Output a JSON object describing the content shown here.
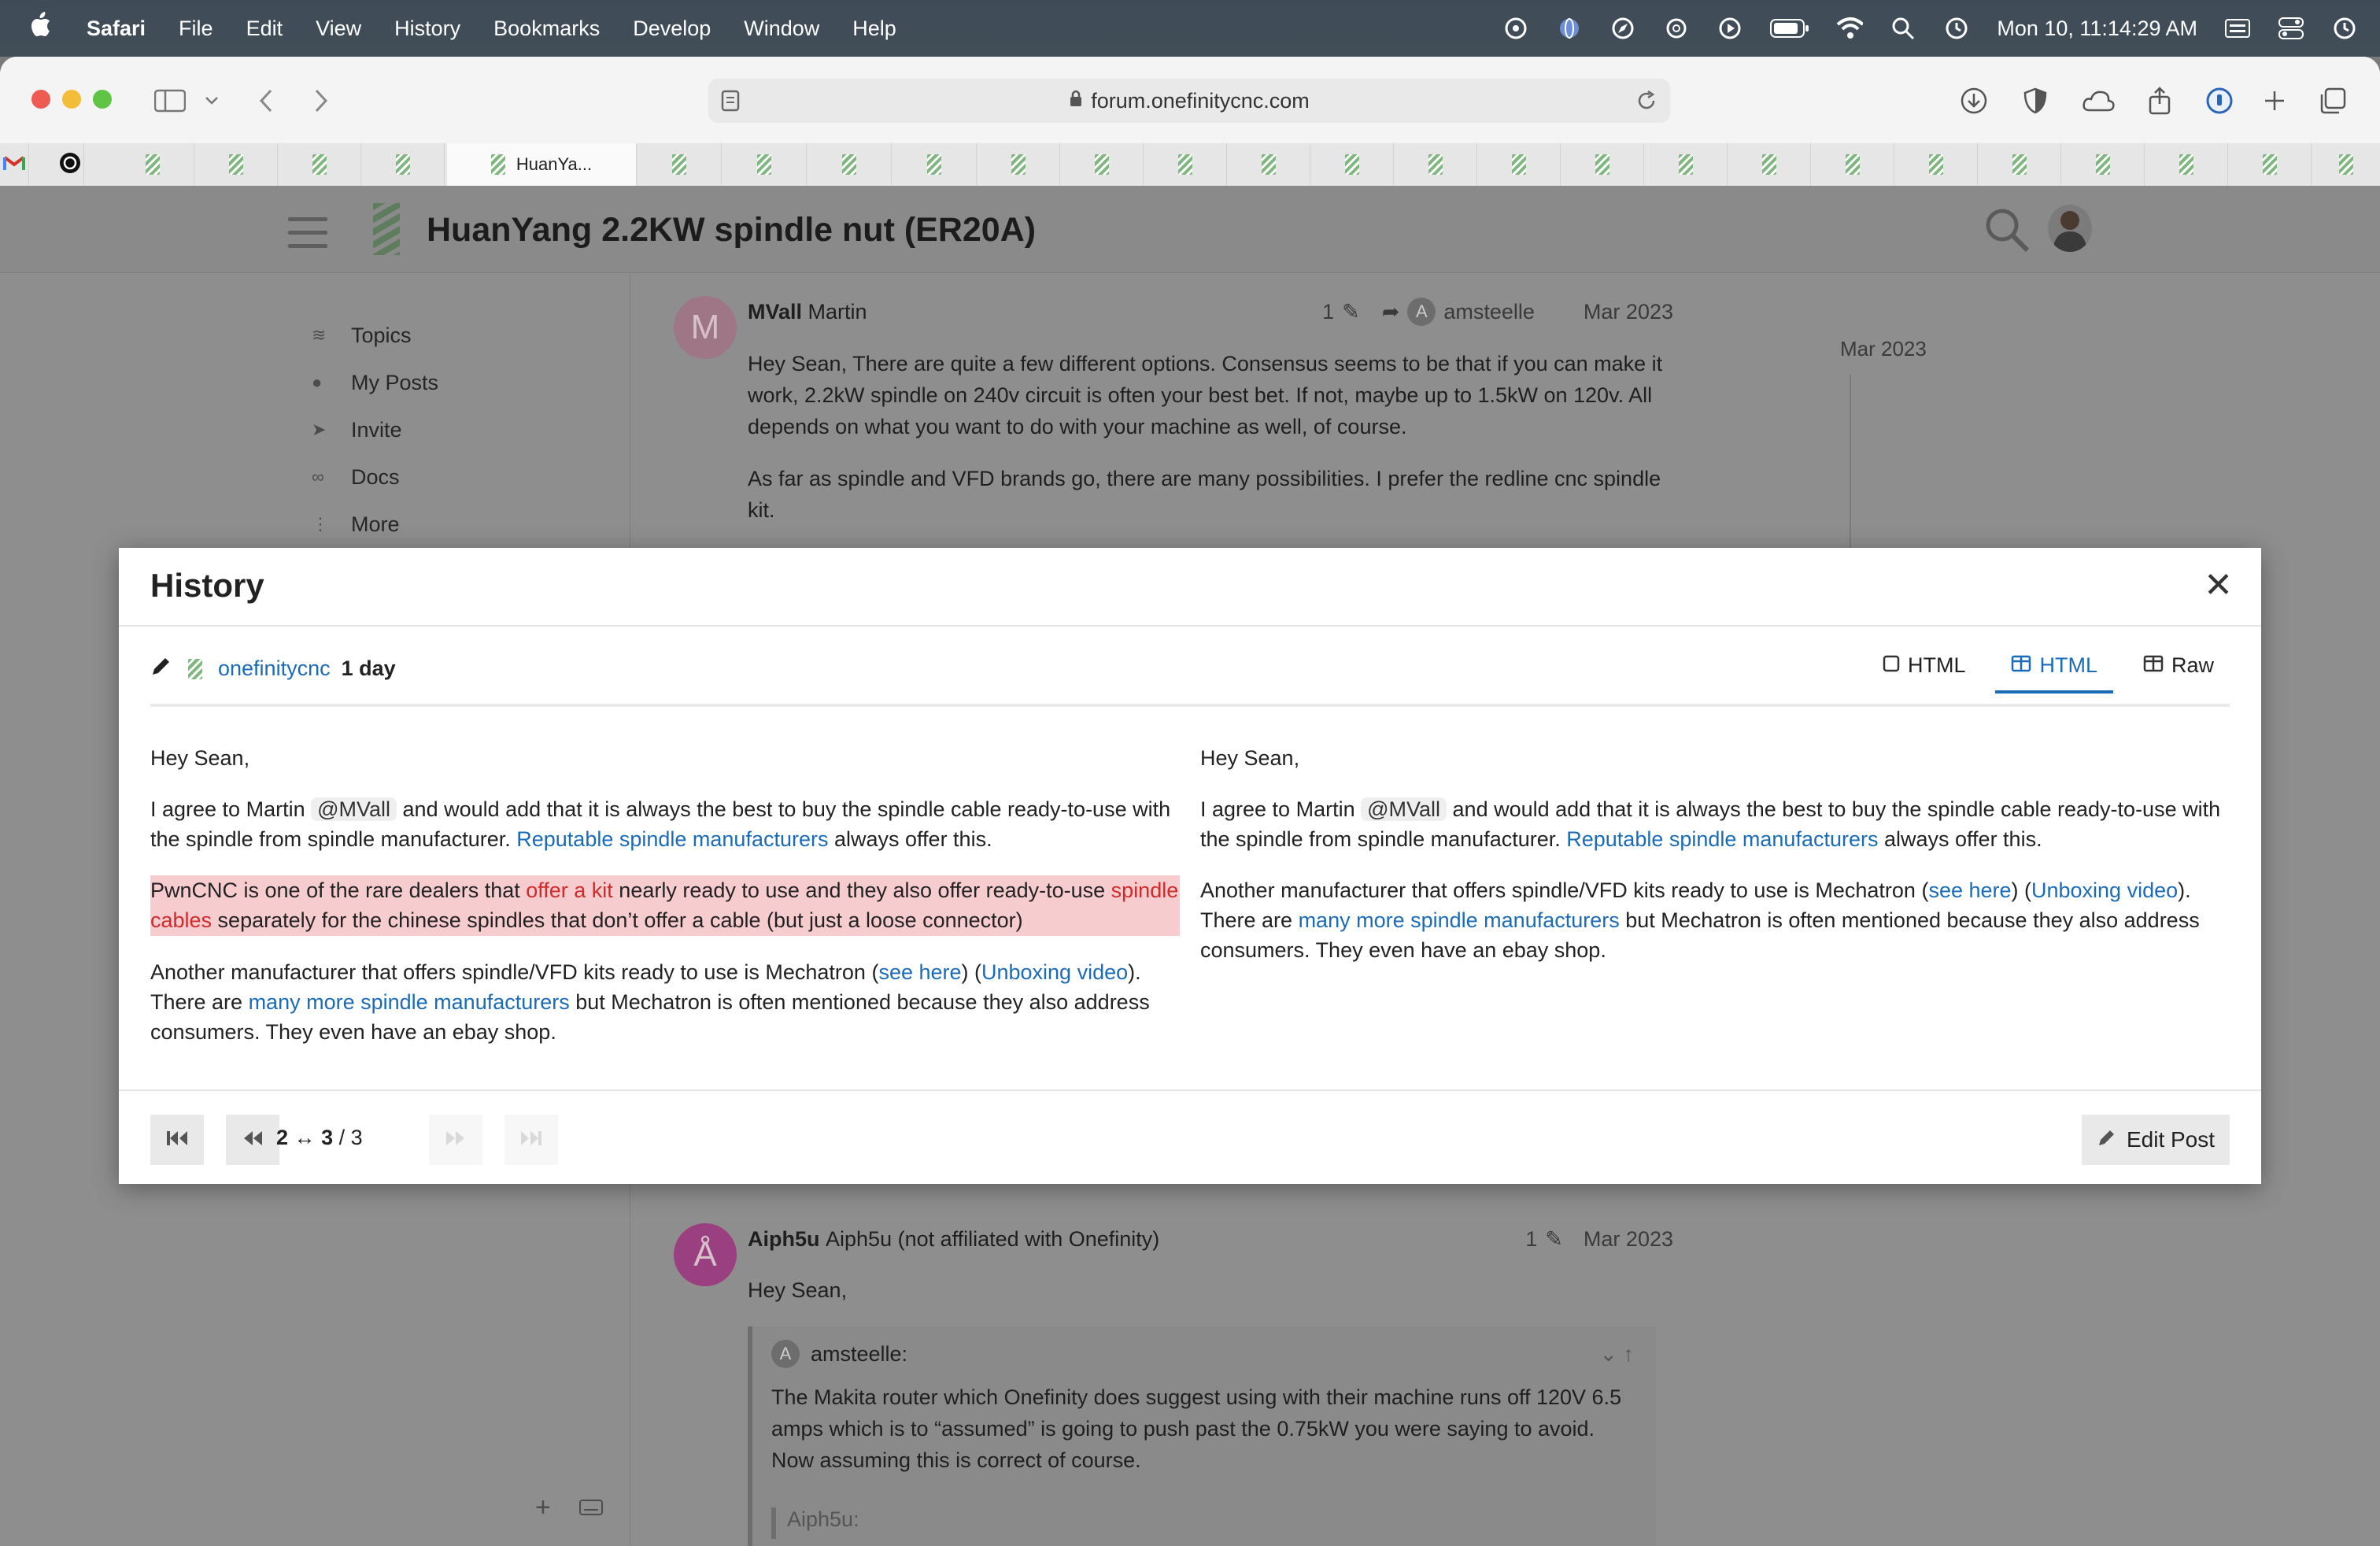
{
  "menubar": {
    "app": "Safari",
    "items": [
      "File",
      "Edit",
      "View",
      "History",
      "Bookmarks",
      "Develop",
      "Window",
      "Help"
    ],
    "clock": "Mon 10, 11:14:29 AM"
  },
  "browser": {
    "url": "forum.onefinitycnc.com",
    "active_tab": "HuanYa..."
  },
  "page": {
    "title": "HuanYang 2.2KW spindle nut (ER20A)",
    "sidebar": [
      "Topics",
      "My Posts",
      "Invite",
      "Docs",
      "More"
    ],
    "timeline_date": "Mar 2023",
    "post1": {
      "username": "MVall",
      "fullname": "Martin",
      "avatar_letter": "M",
      "edits": "1",
      "reply_to": "amsteelle",
      "date": "Mar 2023",
      "p1": "Hey Sean, There are quite a few different options. Consensus seems to be that if you can make it work, 2.2kW spindle on 240v circuit is often your best bet. If not, maybe up to 1.5kW on 120v. All depends on what you want to do with your machine as well, of course.",
      "p2": "As far as spindle and VFD brands go, there are many possibilities. I prefer the redline cnc spindle kit."
    },
    "post2": {
      "username": "Aiph5u",
      "fullname": "Aiph5u (not affiliated with Onefinity)",
      "avatar_letter": "Å",
      "edits": "1",
      "date": "Mar 2023",
      "greeting": "Hey Sean,",
      "quote_author": "amsteelle:",
      "quote_text": "The Makita router which Onefinity does suggest using with their machine runs off 120V 6.5 amps which is to “assumed” is going to push past the 0.75kW you were saying to avoid. Now assuming this is correct of course.",
      "nested_quote_author": "Aiph5u:"
    }
  },
  "modal": {
    "title": "History",
    "editor": "onefinitycnc",
    "age": "1 day",
    "view_tabs": [
      "HTML",
      "HTML",
      "Raw"
    ],
    "left": {
      "greeting": "Hey Sean,",
      "p1_a": "I agree to Martin ",
      "mention": "@MVall",
      "p1_b": " and would add that it is always the best to buy the spindle cable ready-to-use with the spindle from spindle manufacturer. ",
      "p1_link": "Reputable spindle manufacturers",
      "p1_c": " always offer this.",
      "del_a": "PwnCNC is one of the rare dealers that ",
      "del_link1": "offer a kit",
      "del_b": " nearly ready to use and they also offer ready-to-use ",
      "del_link2": "spindle cables",
      "del_c": " separately for the chinese spindles that don’t offer a cable (but just a loose connector)",
      "p3_a": "Another manufacturer that offers spindle/VFD kits ready to use is Mechatron (",
      "p3_link1": "see here",
      "p3_b": ") (",
      "p3_link2": "Unboxing video",
      "p3_c": "). There are ",
      "p3_link3": "many more spindle manufacturers",
      "p3_d": " but Mechatron is often mentioned because they also address consumers. They even have an ebay shop."
    },
    "right": {
      "greeting": "Hey Sean,",
      "p1_a": "I agree to Martin ",
      "mention": "@MVall",
      "p1_b": " and would add that it is always the best to buy the spindle cable ready-to-use with the spindle from spindle manufacturer. ",
      "p1_link": "Reputable spindle manufacturers",
      "p1_c": " always offer this.",
      "p3_a": "Another manufacturer that offers spindle/VFD kits ready to use is Mechatron (",
      "p3_link1": "see here",
      "p3_b": ") (",
      "p3_link2": "Unboxing video",
      "p3_c": "). There are ",
      "p3_link3": "many more spindle manufacturers",
      "p3_d": " but Mechatron is often mentioned because they also address consumers. They even have an ebay shop."
    },
    "footer": {
      "rev_from": "2",
      "rev_to": "3",
      "rev_total": "/ 3",
      "edit_label": "Edit Post"
    }
  },
  "colors": {
    "link": "#1a6bb8",
    "deleted_bg": "#f6cccf",
    "deleted_text": "#d02a2a"
  }
}
